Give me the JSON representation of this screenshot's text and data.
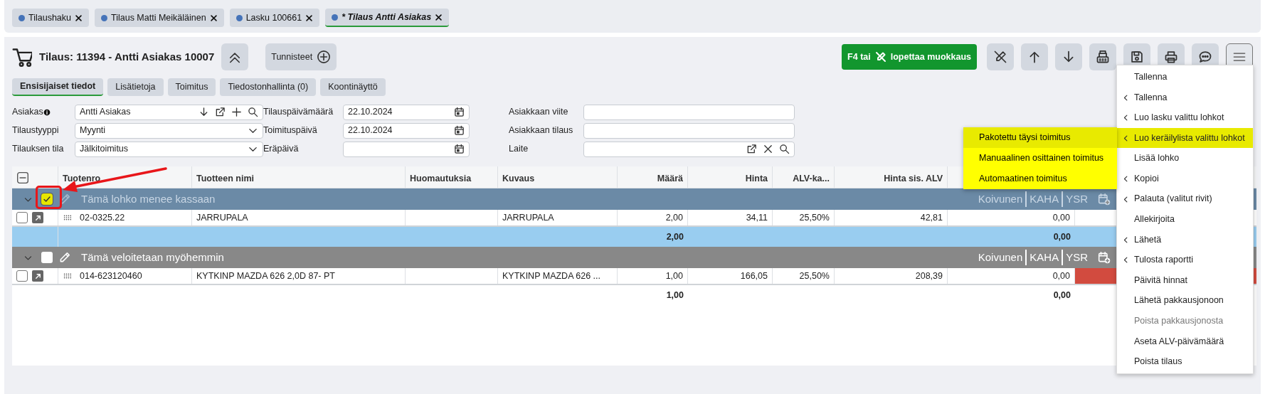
{
  "doc_tabs": [
    {
      "label": "Tilaushaku",
      "selected": false
    },
    {
      "label": "Tilaus Matti Meikäläinen",
      "selected": false
    },
    {
      "label": "Lasku 100661",
      "selected": false
    },
    {
      "label": "* Tilaus Antti Asiakas",
      "selected": true
    }
  ],
  "header": {
    "title": "Tilaus: 11394 - Antti Asiakas 10007",
    "tags_button": "Tunnisteet"
  },
  "edit_button": {
    "before": "F4 tai",
    "after": "lopettaa muokkaus"
  },
  "section_tabs": [
    {
      "label": "Ensisijaiset tiedot",
      "selected": true
    },
    {
      "label": "Lisätietoja",
      "selected": false
    },
    {
      "label": "Toimitus",
      "selected": false
    },
    {
      "label": "Tiedostonhallinta (0)",
      "selected": false
    },
    {
      "label": "Koontinäyttö",
      "selected": false
    }
  ],
  "form": [
    [
      {
        "label": "Asiakas",
        "info": true,
        "value": "Antti Asiakas",
        "kind": "customer"
      },
      {
        "label": "Tilaustyyppi",
        "value": "Myynti",
        "kind": "select"
      },
      {
        "label": "Tilauksen tila",
        "value": "Jälkitoimitus",
        "kind": "select"
      }
    ],
    [
      {
        "label": "Tilauspäivämäärä",
        "value": "22.10.2024",
        "kind": "date"
      },
      {
        "label": "Toimituspäivä",
        "value": "22.10.2024",
        "kind": "date"
      },
      {
        "label": "Eräpäivä",
        "kind": "date"
      }
    ],
    [
      {
        "label": "Asiakkaan viite",
        "kind": "text"
      },
      {
        "label": "Asiakkaan tilaus",
        "kind": "text"
      },
      {
        "label": "Laite",
        "kind": "device"
      }
    ]
  ],
  "table": {
    "select_all_partial": true,
    "columns": [
      "Tuotenro",
      "Tuotteen nimi",
      "Huomautuksia",
      "Kuvaus",
      "Määrä",
      "Hinta",
      "ALV-ka...",
      "Hinta sis. ALV"
    ],
    "groups": [
      {
        "title": "Tämä lohko menee kassaan",
        "checked": true,
        "selected": true,
        "tags": [
          "Koivunen",
          "KAHA",
          "YSR"
        ],
        "rows": [
          {
            "checked": false,
            "alert": false,
            "product_no": "02-0325.22",
            "name": "JARRUPALA",
            "description": "JARRUPALA",
            "qty": "2,00",
            "price": "34,11",
            "vat": "25,50%",
            "price_vat": "42,81",
            "column_9": "0,00"
          }
        ],
        "totals": {
          "qty": "2,00",
          "column_9": "0,00"
        }
      },
      {
        "title": "Tämä veloitetaan myöhemmin",
        "checked": false,
        "selected": false,
        "tags": [
          "Koivunen",
          "KAHA",
          "YSR"
        ],
        "rows": [
          {
            "checked": false,
            "alert": true,
            "product_no": "014-623120460",
            "name": "KYTKINP MAZDA 626 2,0D 87- PT",
            "description": "KYTKINP MAZDA 626 ...",
            "qty": "1,00",
            "price": "166,05",
            "vat": "25,50%",
            "price_vat": "208,39",
            "column_9": "0,00"
          }
        ],
        "totals": {
          "qty": "1,00",
          "column_9": "0,00"
        }
      }
    ]
  },
  "menu": [
    {
      "label": "Tallenna",
      "submenu": false,
      "selected": false,
      "disabled": false
    },
    {
      "label": "Tallenna",
      "submenu": true,
      "selected": false,
      "disabled": false
    },
    {
      "label": "Luo lasku valittu lohkot",
      "submenu": true,
      "selected": false,
      "disabled": false
    },
    {
      "label": "Luo keräilylista valittu lohkot",
      "submenu": true,
      "selected": true,
      "disabled": false,
      "children": [
        {
          "label": "Pakotettu täysi toimitus",
          "selected": true
        },
        {
          "label": "Manuaalinen osittainen toimitus",
          "selected": false
        },
        {
          "label": "Automaatinen toimitus",
          "selected": false
        }
      ]
    },
    {
      "label": "Lisää lohko",
      "submenu": false,
      "selected": false,
      "disabled": false
    },
    {
      "label": "Kopioi",
      "submenu": true,
      "selected": false,
      "disabled": false
    },
    {
      "label": "Palauta (valitut rivit)",
      "submenu": true,
      "selected": false,
      "disabled": false
    },
    {
      "label": "Allekirjoita",
      "submenu": false,
      "selected": false,
      "disabled": false
    },
    {
      "label": "Lähetä",
      "submenu": true,
      "selected": false,
      "disabled": false
    },
    {
      "label": "Tulosta raportti",
      "submenu": true,
      "selected": false,
      "disabled": false
    },
    {
      "label": "Päivitä hinnat",
      "submenu": false,
      "selected": false,
      "disabled": false
    },
    {
      "label": "Lähetä pakkausjonoon",
      "submenu": false,
      "selected": false,
      "disabled": false
    },
    {
      "label": "Poista pakkausjonosta",
      "submenu": false,
      "selected": false,
      "disabled": true
    },
    {
      "label": "Aseta ALV-päivämäärä",
      "submenu": false,
      "selected": false,
      "disabled": false
    },
    {
      "label": "Poista tilaus",
      "submenu": false,
      "selected": false,
      "disabled": false
    }
  ]
}
